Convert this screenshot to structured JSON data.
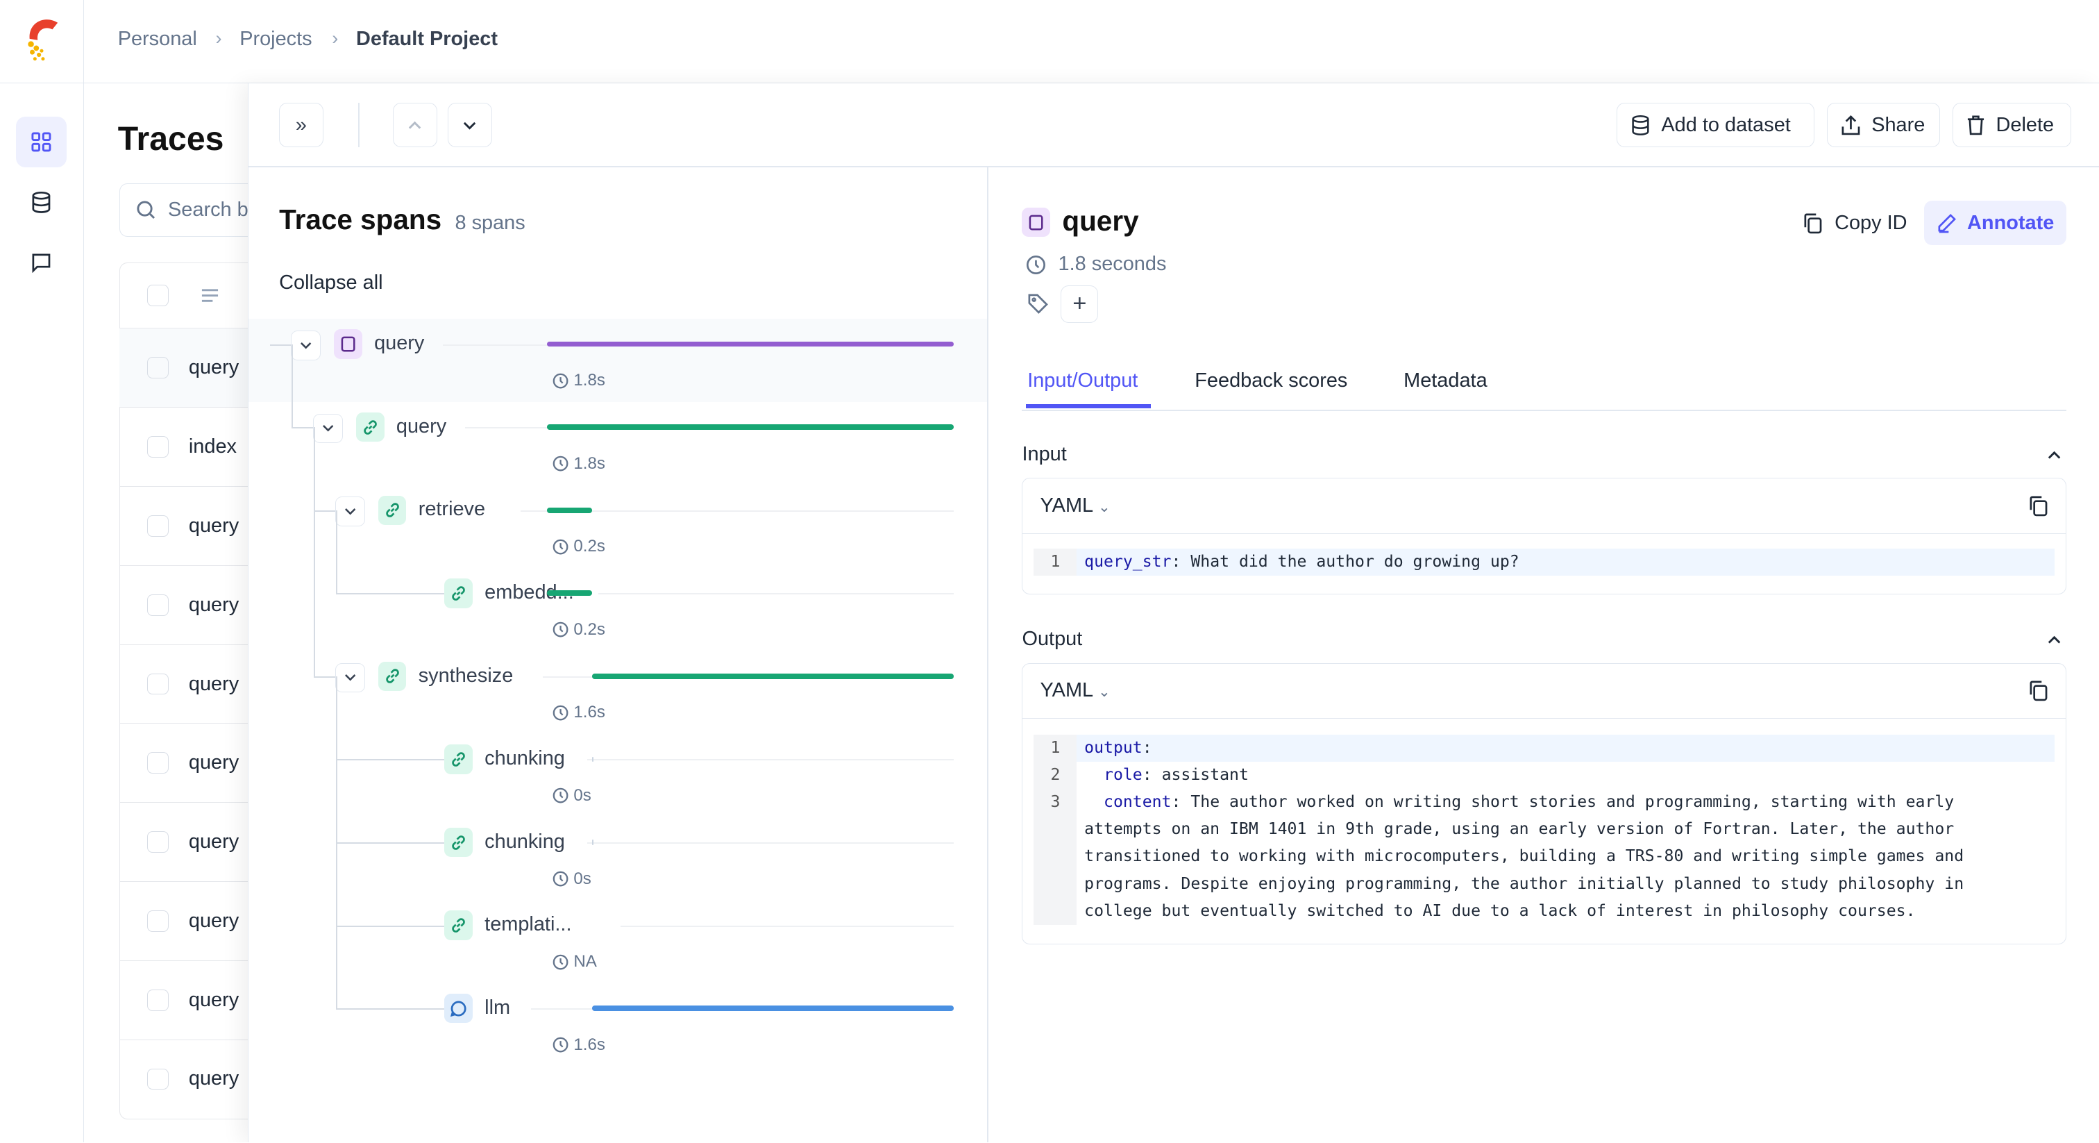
{
  "breadcrumb": [
    "Personal",
    "Projects",
    "Default Project"
  ],
  "rail": {
    "items": [
      {
        "icon": "grid-icon",
        "active": true
      },
      {
        "icon": "database-icon"
      },
      {
        "icon": "chat-icon"
      }
    ]
  },
  "traces": {
    "title": "Traces",
    "search_placeholder": "Search b",
    "rows": [
      "query",
      "index",
      "query",
      "query",
      "query",
      "query",
      "query",
      "query",
      "query",
      "query"
    ]
  },
  "toolbar": {
    "add_to_dataset": "Add to dataset",
    "share": "Share",
    "delete": "Delete"
  },
  "spans_panel": {
    "title": "Trace spans",
    "count": "8 spans",
    "collapse_all": "Collapse all",
    "total_seconds": 1.8,
    "spans": [
      {
        "name": "query",
        "type": "general",
        "level": 0,
        "toggle": true,
        "duration": "1.8s",
        "start": 0,
        "end": 1.8
      },
      {
        "name": "query",
        "type": "chain",
        "level": 1,
        "toggle": true,
        "duration": "1.8s",
        "start": 0,
        "end": 1.8
      },
      {
        "name": "retrieve",
        "type": "chain",
        "level": 2,
        "toggle": true,
        "duration": "0.2s",
        "start": 0,
        "end": 0.2
      },
      {
        "name": "embedd...",
        "type": "chain",
        "level": 3,
        "toggle": false,
        "duration": "0.2s",
        "start": 0,
        "end": 0.2
      },
      {
        "name": "synthesize",
        "type": "chain",
        "level": 2,
        "toggle": true,
        "duration": "1.6s",
        "start": 0.2,
        "end": 1.8
      },
      {
        "name": "chunking",
        "type": "chain",
        "level": 3,
        "toggle": false,
        "duration": "0s",
        "start": 0.2,
        "end": 0.2
      },
      {
        "name": "chunking",
        "type": "chain",
        "level": 3,
        "toggle": false,
        "duration": "0s",
        "start": 0.2,
        "end": 0.2
      },
      {
        "name": "templati...",
        "type": "chain",
        "level": 3,
        "toggle": false,
        "duration": "NA",
        "start": null,
        "end": null
      },
      {
        "name": "llm",
        "type": "llm",
        "level": 3,
        "toggle": false,
        "duration": "1.6s",
        "start": 0.2,
        "end": 1.8
      }
    ]
  },
  "colors": {
    "general": "#935dd0",
    "chain": "#17a673",
    "llm": "#4a90e2",
    "accent": "#5155f5"
  },
  "detail": {
    "title": "query",
    "duration": "1.8 seconds",
    "copy_id": "Copy ID",
    "annotate": "Annotate",
    "tabs": [
      "Input/Output",
      "Feedback scores",
      "Metadata"
    ],
    "active_tab": "Input/Output",
    "input": {
      "label": "Input",
      "format": "YAML",
      "lines": [
        {
          "n": "1",
          "key": "query_str",
          "val": " What did the author do growing up?"
        }
      ]
    },
    "output": {
      "label": "Output",
      "format": "YAML",
      "lines": [
        {
          "n": "1",
          "key": "output",
          "val": ""
        },
        {
          "n": "2",
          "key": "  role",
          "val": " assistant"
        },
        {
          "n": "3",
          "key": "  content",
          "val": " The author worked on writing short stories and programming, starting with early"
        },
        {
          "n": "",
          "key": "",
          "val": "attempts on an IBM 1401 in 9th grade, using an early version of Fortran. Later, the author"
        },
        {
          "n": "",
          "key": "",
          "val": "transitioned to working with microcomputers, building a TRS-80 and writing simple games and"
        },
        {
          "n": "",
          "key": "",
          "val": "programs. Despite enjoying programming, the author initially planned to study philosophy in"
        },
        {
          "n": "",
          "key": "",
          "val": "college but eventually switched to AI due to a lack of interest in philosophy courses."
        }
      ]
    }
  }
}
